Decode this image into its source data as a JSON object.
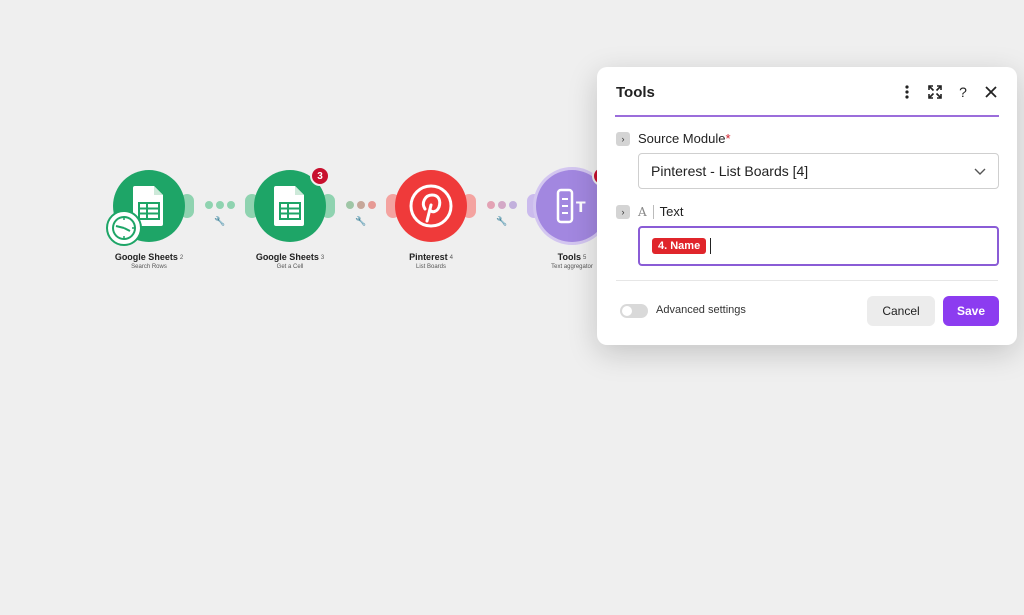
{
  "scenario": {
    "modules": [
      {
        "title": "Google Sheets",
        "num": "2",
        "subtitle": "Search Rows",
        "color": "#1ea567",
        "icon": "google-sheets-icon"
      },
      {
        "title": "Google Sheets",
        "num": "3",
        "subtitle": "Get a Cell",
        "color": "#1ea567",
        "icon": "google-sheets-icon",
        "badge": "3"
      },
      {
        "title": "Pinterest",
        "num": "4",
        "subtitle": "List Boards",
        "color": "#ef3a3a",
        "icon": "pinterest-icon"
      },
      {
        "title": "Tools",
        "num": "5",
        "subtitle": "Text aggregator",
        "color": "#a287e0",
        "icon": "text-aggregator-icon",
        "badge": "3"
      }
    ]
  },
  "dialog": {
    "title": "Tools",
    "source_module_label": "Source Module",
    "required_mark": "*",
    "source_module_value": "Pinterest - List Boards [4]",
    "text_label": "Text",
    "text_type_glyph": "A",
    "text_pill": "4. Name",
    "advanced_label": "Advanced settings",
    "cancel_label": "Cancel",
    "save_label": "Save"
  },
  "colors": {
    "accent": "#8c3cf0",
    "sheets": "#1ea567",
    "pinterest": "#ef3a3a",
    "tools": "#a287e0",
    "badge": "#c8102e"
  }
}
